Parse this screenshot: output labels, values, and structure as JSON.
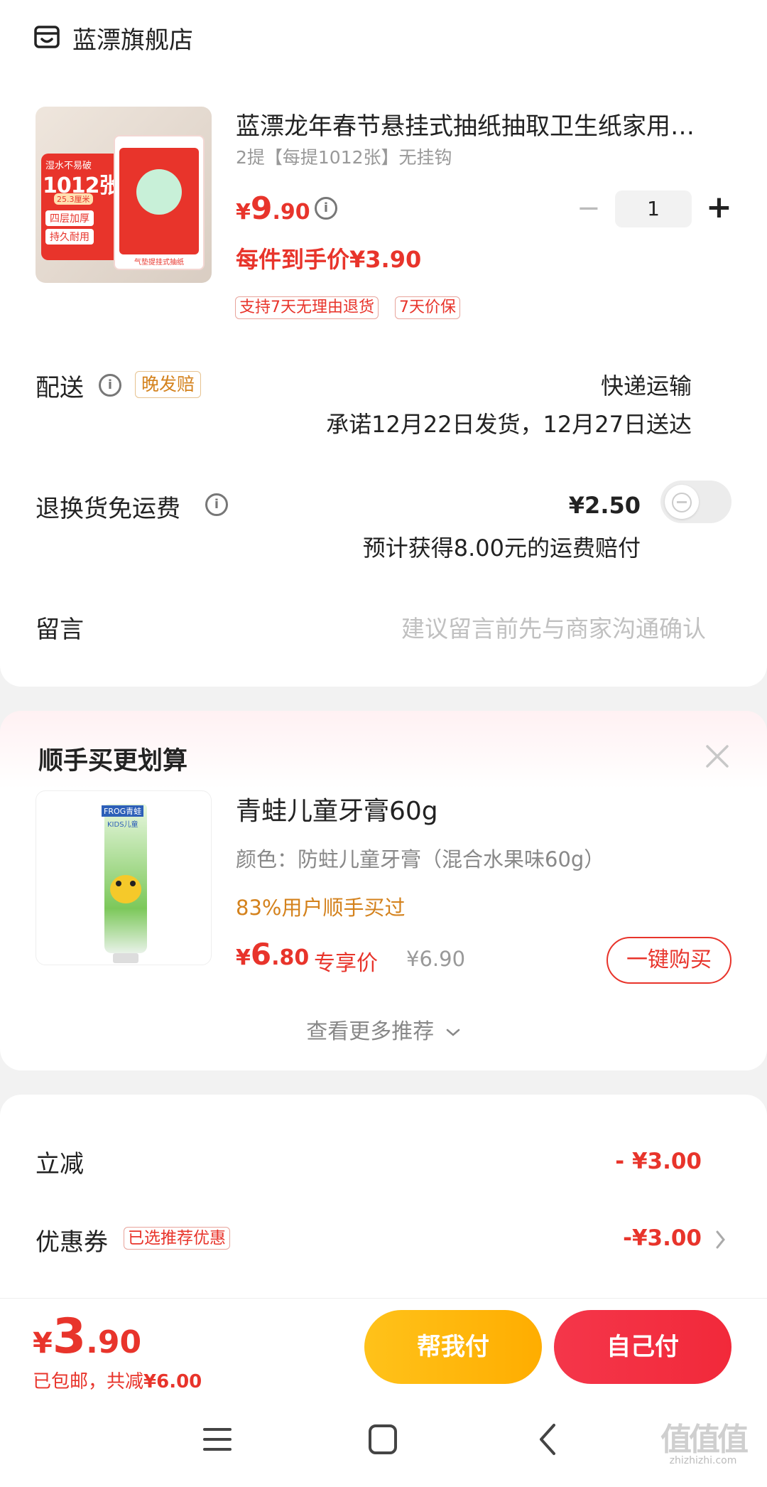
{
  "shop": {
    "icon": "shop-icon",
    "name": "蓝漂旗舰店"
  },
  "product": {
    "image_text": {
      "badge": "湿水不易破",
      "count": "1012张",
      "sub": "25.3厘米",
      "feature1": "四层加厚",
      "feature2": "持久耐用",
      "pack_label": "气垫提挂式抽纸"
    },
    "title": "蓝漂龙年春节悬挂式抽纸抽取卫生纸家用…",
    "spec": "2提【每提1012张】无挂钩",
    "price_symbol": "¥",
    "price_int": "9",
    "price_dec": ".90",
    "final_price": "每件到手价¥3.90",
    "quantity": "1",
    "minus": "−",
    "plus": "+",
    "tags": [
      "支持7天无理由退货",
      "7天价保"
    ]
  },
  "delivery": {
    "label": "配送",
    "tag": "晚发赔",
    "method": "快递运输",
    "promise": "承诺12月22日发货，12月27日送达"
  },
  "return_shipping": {
    "label": "退换货免运费",
    "price": "¥2.50",
    "note": "预计获得8.00元的运费赔付",
    "enabled": false
  },
  "message": {
    "label": "留言",
    "placeholder": "建议留言前先与商家沟通确认"
  },
  "recommend": {
    "title": "顺手买更划算",
    "close_icon": "close-icon",
    "item": {
      "image_text": {
        "brand": "FROG青蛙",
        "kids": "KIDS儿童"
      },
      "name": "青蛙儿童牙膏60g",
      "spec": "颜色：防蛀儿童牙膏（混合水果味60g）",
      "social": "83%用户顺手买过",
      "price_symbol": "¥",
      "price_int": "6",
      "price_dec": ".80",
      "price_label": "专享价",
      "orig_price": "¥6.90",
      "buy_label": "一键购买"
    },
    "more_label": "查看更多推荐"
  },
  "discounts": {
    "instant_label": "立减",
    "instant_value": "- ¥3.00",
    "coupon_label": "优惠券",
    "coupon_tag": "已选推荐优惠",
    "coupon_value": "-¥3.00"
  },
  "footer": {
    "total_symbol": "¥",
    "total_int": "3",
    "total_dec": ".90",
    "summary_prefix": "已包邮，共减",
    "summary_value": "¥6.00",
    "help_pay": "帮我付",
    "self_pay": "自己付"
  },
  "navbar": {
    "menu_icon": "menu-icon",
    "home_icon": "home-icon",
    "back_icon": "back-icon"
  },
  "watermark": {
    "text": "值值值",
    "url": "zhizhizhi.com"
  },
  "colors": {
    "accent": "#e8342b",
    "orange": "#d4821d",
    "yellow_btn": "#ffb400",
    "red_btn": "#f2293a"
  }
}
